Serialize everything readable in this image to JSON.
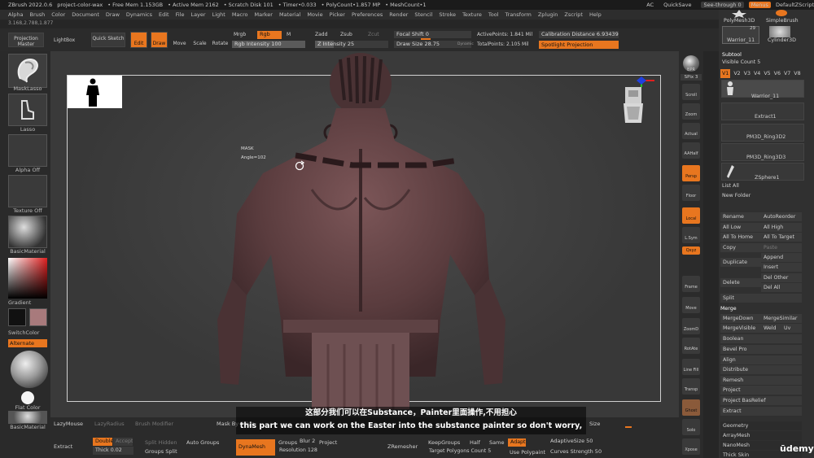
{
  "titlebar": {
    "app": "ZBrush 2022.0.6",
    "project": "project-color-wax",
    "free_mem": "• Free Mem 1.153GB",
    "active_mem": "• Active Mem 2162",
    "scratch": "• Scratch Disk 101",
    "timer": "• Timer•0.033",
    "polycount": "• PolyCount•1.857 MP",
    "meshcount": "• MeshCount•1",
    "ac": "AC",
    "quicksave": "QuickSave",
    "seethrough": "See-through  0",
    "menus": "Menus",
    "script": "DefaultZScript"
  },
  "menubar": [
    "Alpha",
    "Brush",
    "Color",
    "Document",
    "Draw",
    "Dynamics",
    "Edit",
    "File",
    "Layer",
    "Light",
    "Macro",
    "Marker",
    "Material",
    "Movie",
    "Picker",
    "Preferences",
    "Render",
    "Stencil",
    "Stroke",
    "Texture",
    "Tool",
    "Transform",
    "Zplugin",
    "Zscript",
    "Help"
  ],
  "coords": "3.168,2.788,1.877",
  "toolbar": {
    "projection_master": "Projection Master",
    "lightbox": "LightBox",
    "quick_sketch": "Quick Sketch",
    "edit": "Edit",
    "draw": "Draw",
    "move": "Move",
    "scale": "Scale",
    "rotate": "Rotate",
    "mrgb": "Mrgb",
    "rgb": "Rgb",
    "m": "M",
    "rgb_intensity": "Rgb Intensity 100",
    "zadd": "Zadd",
    "zsub": "Zsub",
    "zcut": "Zcut",
    "z_intensity": "Z Intensity 25",
    "focal_shift": "Focal Shift 0",
    "draw_size": "Draw Size 28.75",
    "dynamic": "Dynamic",
    "active_points": "ActivePoints: 1.841 Mil",
    "total_points": "TotalPoints: 2.105 Mil",
    "calibration": "Calibration Distance 6.93439",
    "spotlight": "Spotlight Projection"
  },
  "lefttray": {
    "brush": "MaskLasso",
    "stroke": "Lasso",
    "alpha": "Alpha Off",
    "texture": "Texture Off",
    "material": "BasicMaterial",
    "gradient": "Gradient",
    "switch_color": "SwitchColor",
    "alternate": "Alternate",
    "flat_color": "Flat Color",
    "material2": "BasicMaterial"
  },
  "canvas": {
    "mask_label": "MASK",
    "angle_label": "Angle=102",
    "colors": {
      "skin": "#6b4a4c",
      "skin_dark": "#3e2a2c",
      "mask": "#2a1a1c"
    }
  },
  "rshelf": [
    "BPR",
    "SPix 3",
    "Scroll",
    "Zoom",
    "Actual",
    "AAHalf",
    "Persp",
    "Floor",
    "Local",
    "L.Sym",
    "Qxyz",
    "Frame",
    "Move",
    "ZoomD",
    "RotAte",
    "Line Fill",
    "PolyF",
    "Transp",
    "Ghost",
    "Solo",
    "Xpose"
  ],
  "rpanel": {
    "polymesh": "PolyMesh3D",
    "simplebrush": "SimpleBrush",
    "warrior": "Warrior_11",
    "warrior_count": "29",
    "cylinder": "Cylinder3D",
    "subtool": "Subtool",
    "visible_count": "Visible Count 5",
    "versions": [
      "V1",
      "V2",
      "V3",
      "V4",
      "V5",
      "V6",
      "V7",
      "V8"
    ],
    "subtools": [
      "Warrior_11",
      "Extract1",
      "PM3D_Ring3D2",
      "PM3D_Ring3D3",
      "ZSphere1"
    ],
    "list_all": "List All",
    "new_folder": "New Folder",
    "rename": "Rename",
    "auto_reorder": "AutoReorder",
    "all_low": "All Low",
    "all_high": "All High",
    "all_to_home": "All To Home",
    "all_to_target": "All To Target",
    "copy": "Copy",
    "paste": "Paste",
    "append": "Append",
    "duplicate": "Duplicate",
    "insert": "Insert",
    "delete": "Delete",
    "del_other": "Del Other",
    "del_all": "Del All",
    "split": "Split",
    "merge": "Merge",
    "merge_down": "MergeDown",
    "merge_similar": "MergeSimilar",
    "merge_visible": "MergeVisible",
    "weld": "Weld",
    "uv": "Uv",
    "boolean": "Boolean",
    "bevel_pro": "Bevel Pro",
    "align": "Align",
    "distribute": "Distribute",
    "remesh": "Remesh",
    "project": "Project",
    "project_bas_relief": "Project BasRelief",
    "extract": "Extract",
    "geometry": "Geometry",
    "arraymesh": "ArrayMesh",
    "nanomesh": "NanoMesh",
    "thick_skin": "Thick Skin"
  },
  "bottom": {
    "lazymouse": "LazyMouse",
    "lazyradius": "LazyRadius",
    "brush_modifier": "Brush Modifier",
    "mask_by_poly": "Mask By Polyg",
    "size": "Size",
    "extract": "Extract",
    "double": "Double",
    "accept": "Accept",
    "thick": "Thick 0.02",
    "split_hidden": "Split Hidden",
    "groups_split": "Groups Split",
    "auto_groups": "Auto Groups",
    "dynamesh": "DynaMesh",
    "groups": "Groups",
    "blur": "Blur 2",
    "project": "Project",
    "resolution": "Resolution 128",
    "zremesher": "ZRemesher",
    "keep_groups": "KeepGroups",
    "half": "Half",
    "same": "Same",
    "adapt": "Adapt",
    "adaptive_size": "AdaptiveSize 50",
    "target_polygons": "Target Polygons Count 5",
    "use_polypaint": "Use Polypaint",
    "curves_strength": "Curves Strength 50"
  },
  "subtitles": {
    "line1": "这部分我们可以在Substance，Painter里面操作,不用担心",
    "line2": "this part we can work on the Easter into the substance painter so don't worry,"
  },
  "watermark": "ūdemy"
}
